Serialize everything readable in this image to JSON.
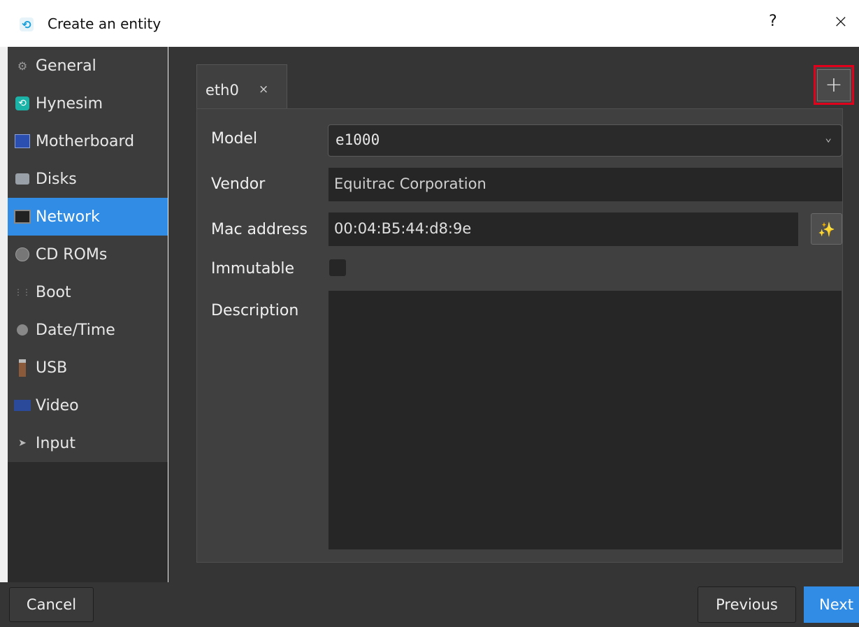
{
  "window": {
    "title": "Create an entity",
    "help": "?",
    "close": "×"
  },
  "sidebar": {
    "items": [
      {
        "label": "General",
        "icon": "gear-icon"
      },
      {
        "label": "Hynesim",
        "icon": "hynesim-logo-icon"
      },
      {
        "label": "Motherboard",
        "icon": "motherboard-icon"
      },
      {
        "label": "Disks",
        "icon": "disk-icon"
      },
      {
        "label": "Network",
        "icon": "network-icon"
      },
      {
        "label": "CD ROMs",
        "icon": "cdrom-icon"
      },
      {
        "label": "Boot",
        "icon": "boot-icon"
      },
      {
        "label": "Date/Time",
        "icon": "clock-icon"
      },
      {
        "label": "USB",
        "icon": "usb-icon"
      },
      {
        "label": "Video",
        "icon": "monitor-icon"
      },
      {
        "label": "Input",
        "icon": "cursor-icon"
      }
    ],
    "active": "Network"
  },
  "tabs": [
    {
      "label": "eth0",
      "close": "×"
    }
  ],
  "add_button": "+",
  "form": {
    "model_label": "Model",
    "model_value": "e1000",
    "vendor_label": "Vendor",
    "vendor_value": "Equitrac Corporation",
    "mac_label": "Mac address",
    "mac_value": "00:04:B5:44:d8:9e",
    "immutable_label": "Immutable",
    "immutable_checked": false,
    "description_label": "Description",
    "description_value": ""
  },
  "footer": {
    "cancel": "Cancel",
    "previous": "Previous",
    "next": "Next"
  },
  "colors": {
    "accent": "#308ce4",
    "highlight": "#e0001b"
  }
}
